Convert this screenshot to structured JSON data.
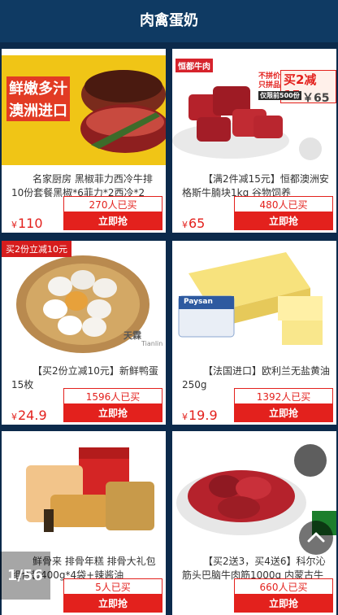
{
  "header": {
    "title": "肉禽蛋奶"
  },
  "products": [
    {
      "title": "名家厨房 黑椒菲力西冷牛排10份套餐黑椒*6菲力*2西冷*2",
      "sold": "270人已买",
      "buy": "立即抢",
      "price": "110",
      "image_text": [
        "鲜嫩多汁",
        "澳洲进口"
      ]
    },
    {
      "title": "【满2件减15元】恒都澳洲安格斯牛腩块1kg 谷物饲养",
      "sold": "480人已买",
      "buy": "立即抢",
      "price": "65",
      "image_text": [
        "恒都牛肉",
        "不拼价格",
        "只拼品质",
        "买2减15",
        "仅限前500份",
        "￥65"
      ]
    },
    {
      "title": "【买2份立减10元】新鲜鸭蛋 15枚",
      "sold": "1596人已买",
      "buy": "立即抢",
      "price": "24.9",
      "corner_tag": "买2份立减10元",
      "image_text": [
        "天霖",
        "Tianlin"
      ]
    },
    {
      "title": "【法国进口】欧利兰无盐黄油250g",
      "sold": "1392人已买",
      "buy": "立即抢",
      "price": "19.9",
      "image_text": [
        "Paysan"
      ]
    },
    {
      "title": "鲜骨来 排骨年糕 排骨大礼包组合装400g*4袋+辣酱油",
      "sold": "5人已买",
      "buy": "立即抢",
      "price": "",
      "image_text": []
    },
    {
      "title": "【买2送3，买4送6】科尔沁 筋头巴脑牛肉筋1000g 内蒙古牛",
      "sold": "660人已买",
      "buy": "立即抢",
      "price": "",
      "image_text": []
    }
  ],
  "currency": "¥",
  "pager": {
    "label": "1/56"
  }
}
